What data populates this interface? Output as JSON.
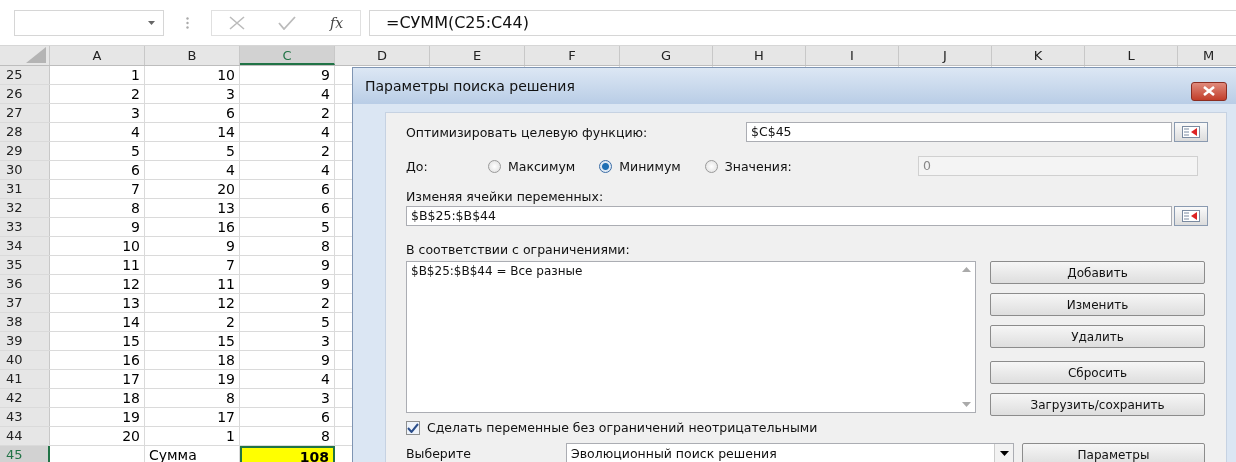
{
  "formula_bar": {
    "function_label": "fx",
    "formula": "=СУММ(C25:C44)"
  },
  "columns": [
    {
      "label": "A",
      "selected": false
    },
    {
      "label": "B",
      "selected": false
    },
    {
      "label": "C",
      "selected": true
    },
    {
      "label": "D",
      "selected": false
    },
    {
      "label": "E",
      "selected": false
    },
    {
      "label": "F",
      "selected": false
    },
    {
      "label": "G",
      "selected": false
    },
    {
      "label": "H",
      "selected": false
    },
    {
      "label": "I",
      "selected": false
    },
    {
      "label": "J",
      "selected": false
    },
    {
      "label": "K",
      "selected": false
    },
    {
      "label": "L",
      "selected": false
    },
    {
      "label": "M",
      "selected": false
    }
  ],
  "rows": [
    {
      "number": "25",
      "selected": false,
      "cells": [
        {
          "kind": "number",
          "text": "1"
        },
        {
          "kind": "number",
          "text": "10"
        },
        {
          "kind": "number",
          "text": "9"
        }
      ]
    },
    {
      "number": "26",
      "selected": false,
      "cells": [
        {
          "kind": "number",
          "text": "2"
        },
        {
          "kind": "number",
          "text": "3"
        },
        {
          "kind": "number",
          "text": "4"
        }
      ]
    },
    {
      "number": "27",
      "selected": false,
      "cells": [
        {
          "kind": "number",
          "text": "3"
        },
        {
          "kind": "number",
          "text": "6"
        },
        {
          "kind": "number",
          "text": "2"
        }
      ]
    },
    {
      "number": "28",
      "selected": false,
      "cells": [
        {
          "kind": "number",
          "text": "4"
        },
        {
          "kind": "number",
          "text": "14"
        },
        {
          "kind": "number",
          "text": "4"
        }
      ]
    },
    {
      "number": "29",
      "selected": false,
      "cells": [
        {
          "kind": "number",
          "text": "5"
        },
        {
          "kind": "number",
          "text": "5"
        },
        {
          "kind": "number",
          "text": "2"
        }
      ]
    },
    {
      "number": "30",
      "selected": false,
      "cells": [
        {
          "kind": "number",
          "text": "6"
        },
        {
          "kind": "number",
          "text": "4"
        },
        {
          "kind": "number",
          "text": "4"
        }
      ]
    },
    {
      "number": "31",
      "selected": false,
      "cells": [
        {
          "kind": "number",
          "text": "7"
        },
        {
          "kind": "number",
          "text": "20"
        },
        {
          "kind": "number",
          "text": "6"
        }
      ]
    },
    {
      "number": "32",
      "selected": false,
      "cells": [
        {
          "kind": "number",
          "text": "8"
        },
        {
          "kind": "number",
          "text": "13"
        },
        {
          "kind": "number",
          "text": "6"
        }
      ]
    },
    {
      "number": "33",
      "selected": false,
      "cells": [
        {
          "kind": "number",
          "text": "9"
        },
        {
          "kind": "number",
          "text": "16"
        },
        {
          "kind": "number",
          "text": "5"
        }
      ]
    },
    {
      "number": "34",
      "selected": false,
      "cells": [
        {
          "kind": "number",
          "text": "10"
        },
        {
          "kind": "number",
          "text": "9"
        },
        {
          "kind": "number",
          "text": "8"
        }
      ]
    },
    {
      "number": "35",
      "selected": false,
      "cells": [
        {
          "kind": "number",
          "text": "11"
        },
        {
          "kind": "number",
          "text": "7"
        },
        {
          "kind": "number",
          "text": "9"
        }
      ]
    },
    {
      "number": "36",
      "selected": false,
      "cells": [
        {
          "kind": "number",
          "text": "12"
        },
        {
          "kind": "number",
          "text": "11"
        },
        {
          "kind": "number",
          "text": "9"
        }
      ]
    },
    {
      "number": "37",
      "selected": false,
      "cells": [
        {
          "kind": "number",
          "text": "13"
        },
        {
          "kind": "number",
          "text": "12"
        },
        {
          "kind": "number",
          "text": "2"
        }
      ]
    },
    {
      "number": "38",
      "selected": false,
      "cells": [
        {
          "kind": "number",
          "text": "14"
        },
        {
          "kind": "number",
          "text": "2"
        },
        {
          "kind": "number",
          "text": "5"
        }
      ]
    },
    {
      "number": "39",
      "selected": false,
      "cells": [
        {
          "kind": "number",
          "text": "15"
        },
        {
          "kind": "number",
          "text": "15"
        },
        {
          "kind": "number",
          "text": "3"
        }
      ]
    },
    {
      "number": "40",
      "selected": false,
      "cells": [
        {
          "kind": "number",
          "text": "16"
        },
        {
          "kind": "number",
          "text": "18"
        },
        {
          "kind": "number",
          "text": "9"
        }
      ]
    },
    {
      "number": "41",
      "selected": false,
      "cells": [
        {
          "kind": "number",
          "text": "17"
        },
        {
          "kind": "number",
          "text": "19"
        },
        {
          "kind": "number",
          "text": "4"
        }
      ]
    },
    {
      "number": "42",
      "selected": false,
      "cells": [
        {
          "kind": "number",
          "text": "18"
        },
        {
          "kind": "number",
          "text": "8"
        },
        {
          "kind": "number",
          "text": "3"
        }
      ]
    },
    {
      "number": "43",
      "selected": false,
      "cells": [
        {
          "kind": "number",
          "text": "19"
        },
        {
          "kind": "number",
          "text": "17"
        },
        {
          "kind": "number",
          "text": "6"
        }
      ]
    },
    {
      "number": "44",
      "selected": false,
      "cells": [
        {
          "kind": "number",
          "text": "20"
        },
        {
          "kind": "number",
          "text": "1"
        },
        {
          "kind": "number",
          "text": "8"
        }
      ]
    },
    {
      "number": "45",
      "selected": true,
      "cells": [
        {
          "kind": "empty"
        },
        {
          "kind": "label",
          "text": "Сумма"
        },
        {
          "kind": "number",
          "text": "108",
          "selected": true,
          "color": "#ffff00"
        }
      ]
    }
  ],
  "dialog": {
    "title": "Параметры поиска решения",
    "objective": {
      "label": "Оптимизировать целевую функцию:",
      "value": "$C$45"
    },
    "to": {
      "label": "До:",
      "options": [
        {
          "label": "Максимум",
          "selected": false
        },
        {
          "label": "Минимум",
          "selected": true
        },
        {
          "label": "Значения:",
          "selected": false
        }
      ],
      "value": "0",
      "value_disabled": true
    },
    "variables": {
      "label": "Изменяя ячейки переменных:",
      "value": "$B$25:$B$44"
    },
    "constraints": {
      "label": "В соответствии с ограничениями:",
      "items": [
        "$B$25:$B$44 = Все разные"
      ]
    },
    "edit_buttons": [
      "Добавить",
      "Изменить",
      "Удалить"
    ],
    "file_buttons": [
      "Сбросить",
      "Загрузить/сохранить"
    ],
    "nonnegative": {
      "label": "Сделать переменные без ограничений неотрицательными",
      "checked": true
    },
    "method": {
      "label": "Выберите",
      "value": "Эволюционный поиск решения",
      "button": "Параметры"
    }
  }
}
